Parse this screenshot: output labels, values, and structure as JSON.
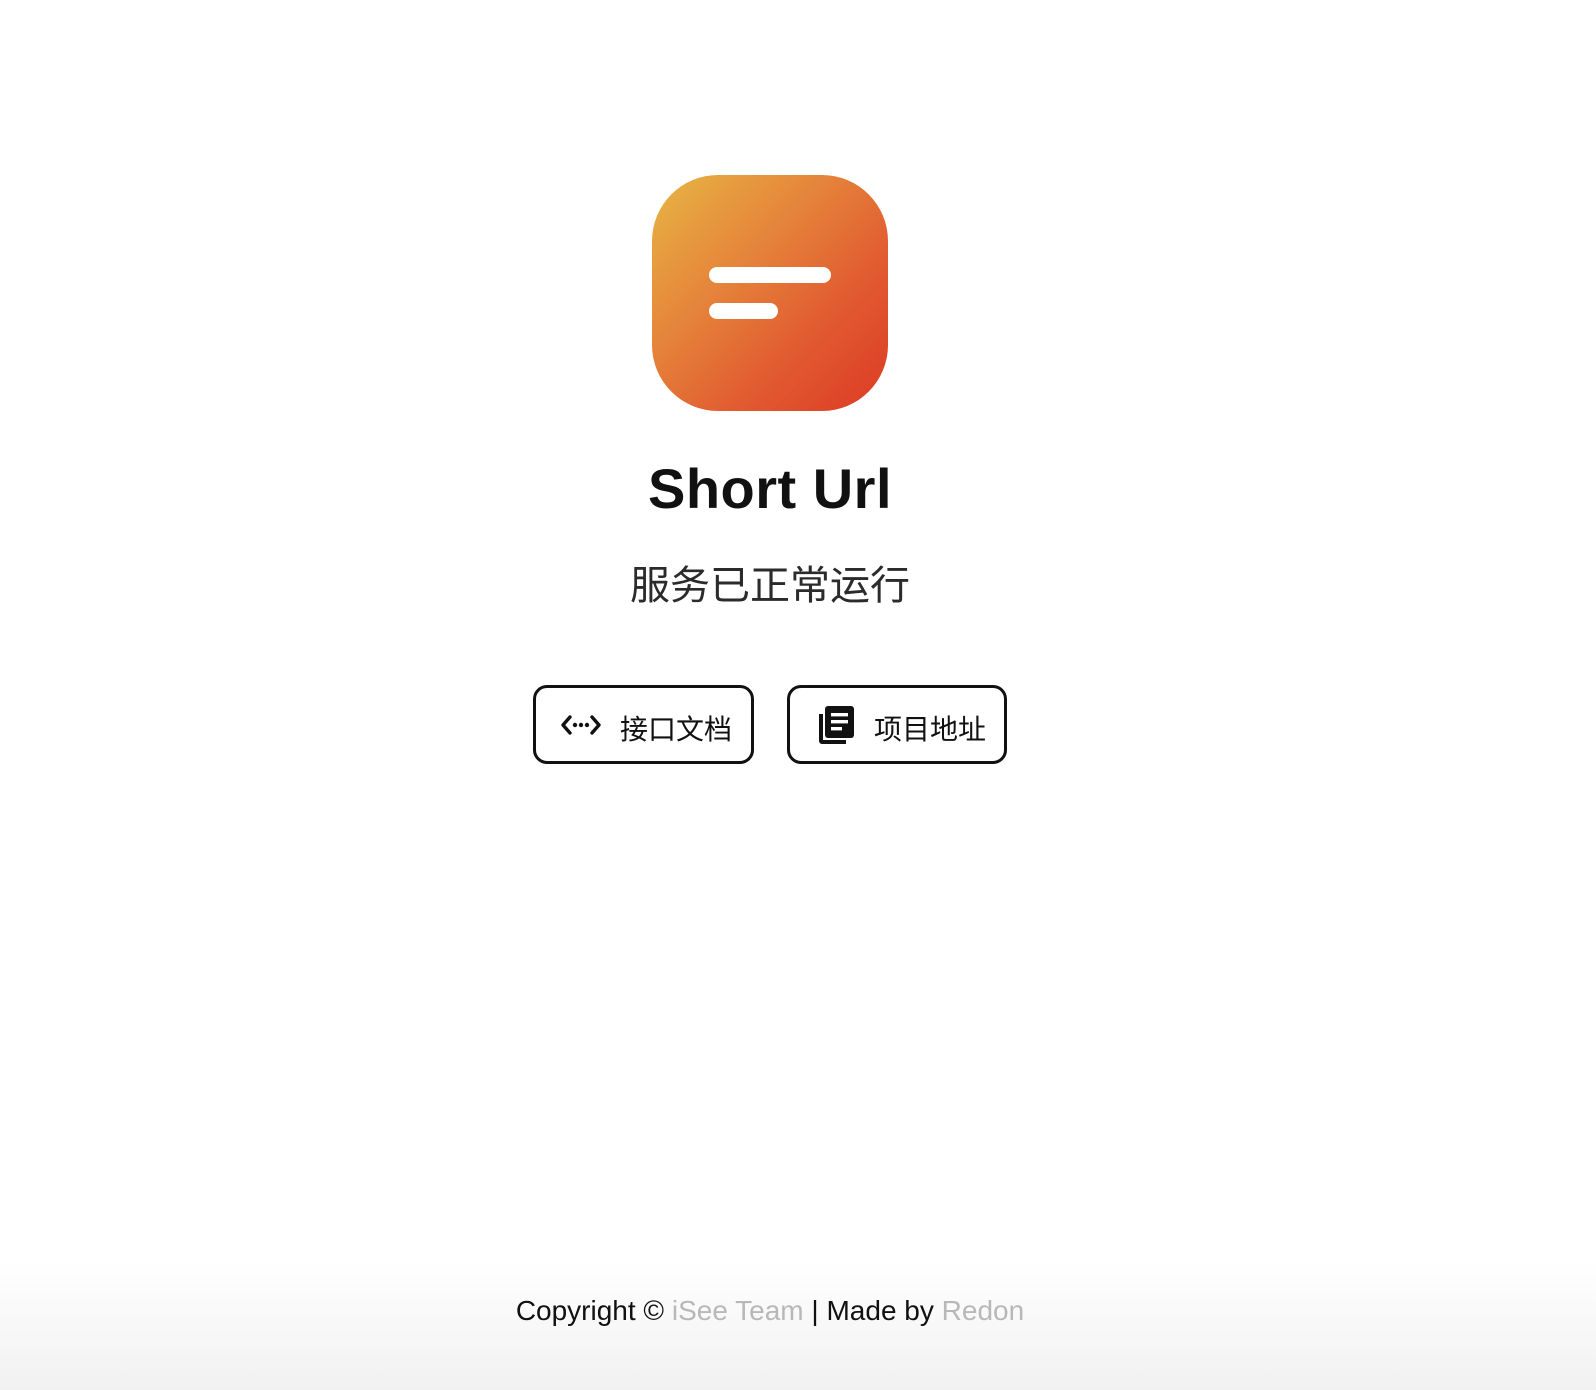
{
  "app": {
    "title": "Short Url",
    "status": "服务已正常运行",
    "logo_icon": "short-lines-icon",
    "logo_gradient": [
      "#e8b644",
      "#dc3a24"
    ]
  },
  "actions": [
    {
      "label": "接口文档",
      "icon": "code-brackets-icon"
    },
    {
      "label": "项目地址",
      "icon": "library-books-icon"
    }
  ],
  "footer": {
    "copyright_prefix": "Copyright ©",
    "team_link": "iSee Team",
    "separator": "|",
    "made_by": "Made by",
    "author_link": "Redon",
    "link_color": "#b8b8b8"
  }
}
